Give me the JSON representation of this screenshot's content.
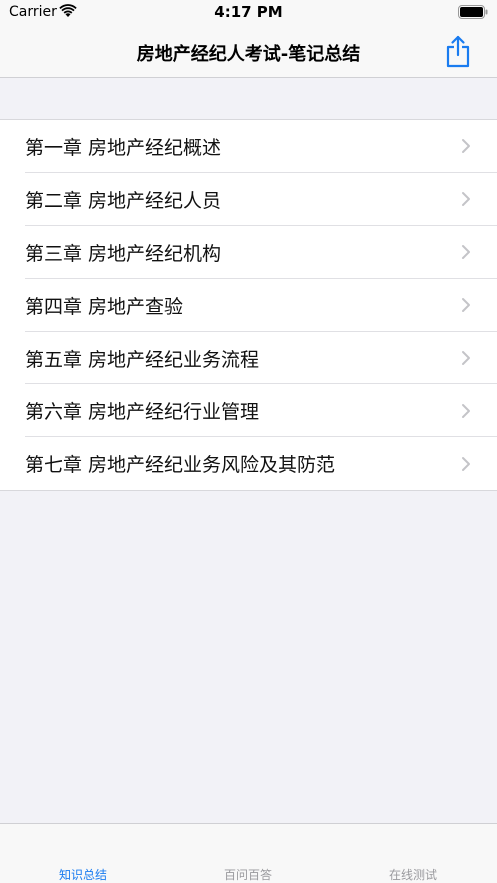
{
  "status_bar": {
    "carrier": "Carrier",
    "time": "4:17 PM"
  },
  "nav": {
    "title": "房地产经纪人考试-笔记总结",
    "share_icon": "share-icon"
  },
  "chapters": [
    {
      "label": "第一章 房地产经纪概述"
    },
    {
      "label": "第二章 房地产经纪人员"
    },
    {
      "label": "第三章 房地产经纪机构"
    },
    {
      "label": "第四章 房地产查验"
    },
    {
      "label": "第五章 房地产经纪业务流程"
    },
    {
      "label": "第六章 房地产经纪行业管理"
    },
    {
      "label": "第七章 房地产经纪业务风险及其防范"
    }
  ],
  "tabs": [
    {
      "label": "知识总结",
      "active": true
    },
    {
      "label": "百问百答",
      "active": false
    },
    {
      "label": "在线测试",
      "active": false
    }
  ],
  "colors": {
    "accent": "#1a7cf0",
    "background": "#f2f2f7",
    "inactive_tab": "#9a9a9e"
  }
}
